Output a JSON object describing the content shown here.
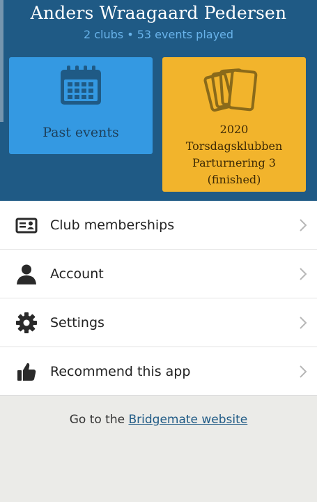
{
  "profile": {
    "name": "Anders Wraagaard Pedersen",
    "clubs": "2 clubs",
    "separator": "•",
    "events": "53 events played"
  },
  "tiles": {
    "past": {
      "label": "Past events",
      "icon": "calendar-icon"
    },
    "current": {
      "line1": "2020",
      "line2": "Torsdagsklubben",
      "line3": "Parturnering 3",
      "line4": "(finished)",
      "icon": "cards-icon"
    }
  },
  "menu": [
    {
      "label": "Club memberships",
      "icon": "id-card-icon"
    },
    {
      "label": "Account",
      "icon": "person-icon"
    },
    {
      "label": "Settings",
      "icon": "gear-icon"
    },
    {
      "label": "Recommend this app",
      "icon": "thumbs-up-icon"
    }
  ],
  "footer": {
    "prefix": "Go to the",
    "link": "Bridgemate website"
  },
  "colors": {
    "header": "#1f5a85",
    "past_tile": "#3499e2",
    "event_tile": "#f2b42c",
    "background": "#ebebe8"
  }
}
